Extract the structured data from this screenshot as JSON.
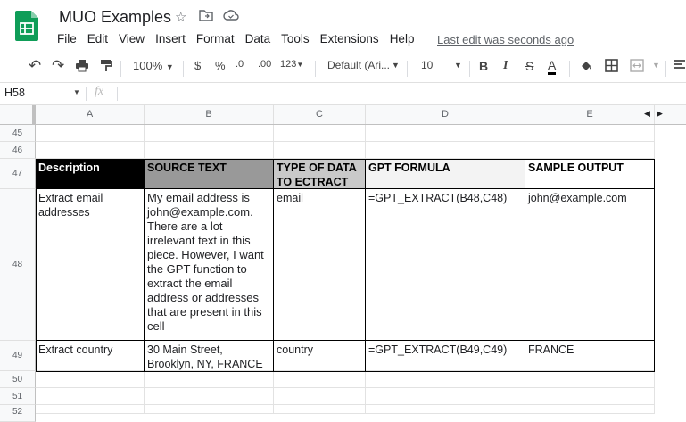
{
  "app": {
    "title": "MUO Examples",
    "menu": [
      "File",
      "Edit",
      "View",
      "Insert",
      "Format",
      "Data",
      "Tools",
      "Extensions",
      "Help"
    ],
    "last_edit": "Last edit was seconds ago"
  },
  "toolbar": {
    "zoom": "100%",
    "currency": "$",
    "percent": "%",
    "dec_decrease": ".0",
    "dec_increase": ".00",
    "more_formats": "123",
    "font": "Default (Ari...",
    "font_size": "10",
    "bold": "B",
    "italic": "I",
    "strike": "S",
    "text_color": "A"
  },
  "formula_bar": {
    "cell_ref": "H58",
    "fx": "fx",
    "value": ""
  },
  "columns": [
    "A",
    "B",
    "C",
    "D",
    "E"
  ],
  "rows": {
    "r45": "45",
    "r46": "46",
    "r47": "47",
    "r48": "48",
    "r49": "49",
    "r50": "50",
    "r51": "51",
    "r52": "52"
  },
  "table": {
    "headers": [
      "Description",
      "SOURCE TEXT",
      "TYPE OF DATA TO ECTRACT",
      "GPT FORMULA",
      "SAMPLE OUTPUT"
    ],
    "row48": [
      "Extract email addresses",
      "My email address is john@example.com. There are a lot irrelevant text in this piece. However, I want the GPT function to extract the email address or addresses that are present in this cell",
      "email",
      "=GPT_EXTRACT(B48,C48)",
      "john@example.com"
    ],
    "row49": [
      "Extract country",
      "30 Main Street, Brooklyn, NY, FRANCE",
      "country",
      "=GPT_EXTRACT(B49,C49)",
      "FRANCE"
    ]
  },
  "colors": {
    "sheets_green": "#0f9d58",
    "header_black": "#000000",
    "header_gray": "#999999",
    "header_lightgray": "#c9c9c9",
    "header_white": "#f3f3f3"
  }
}
